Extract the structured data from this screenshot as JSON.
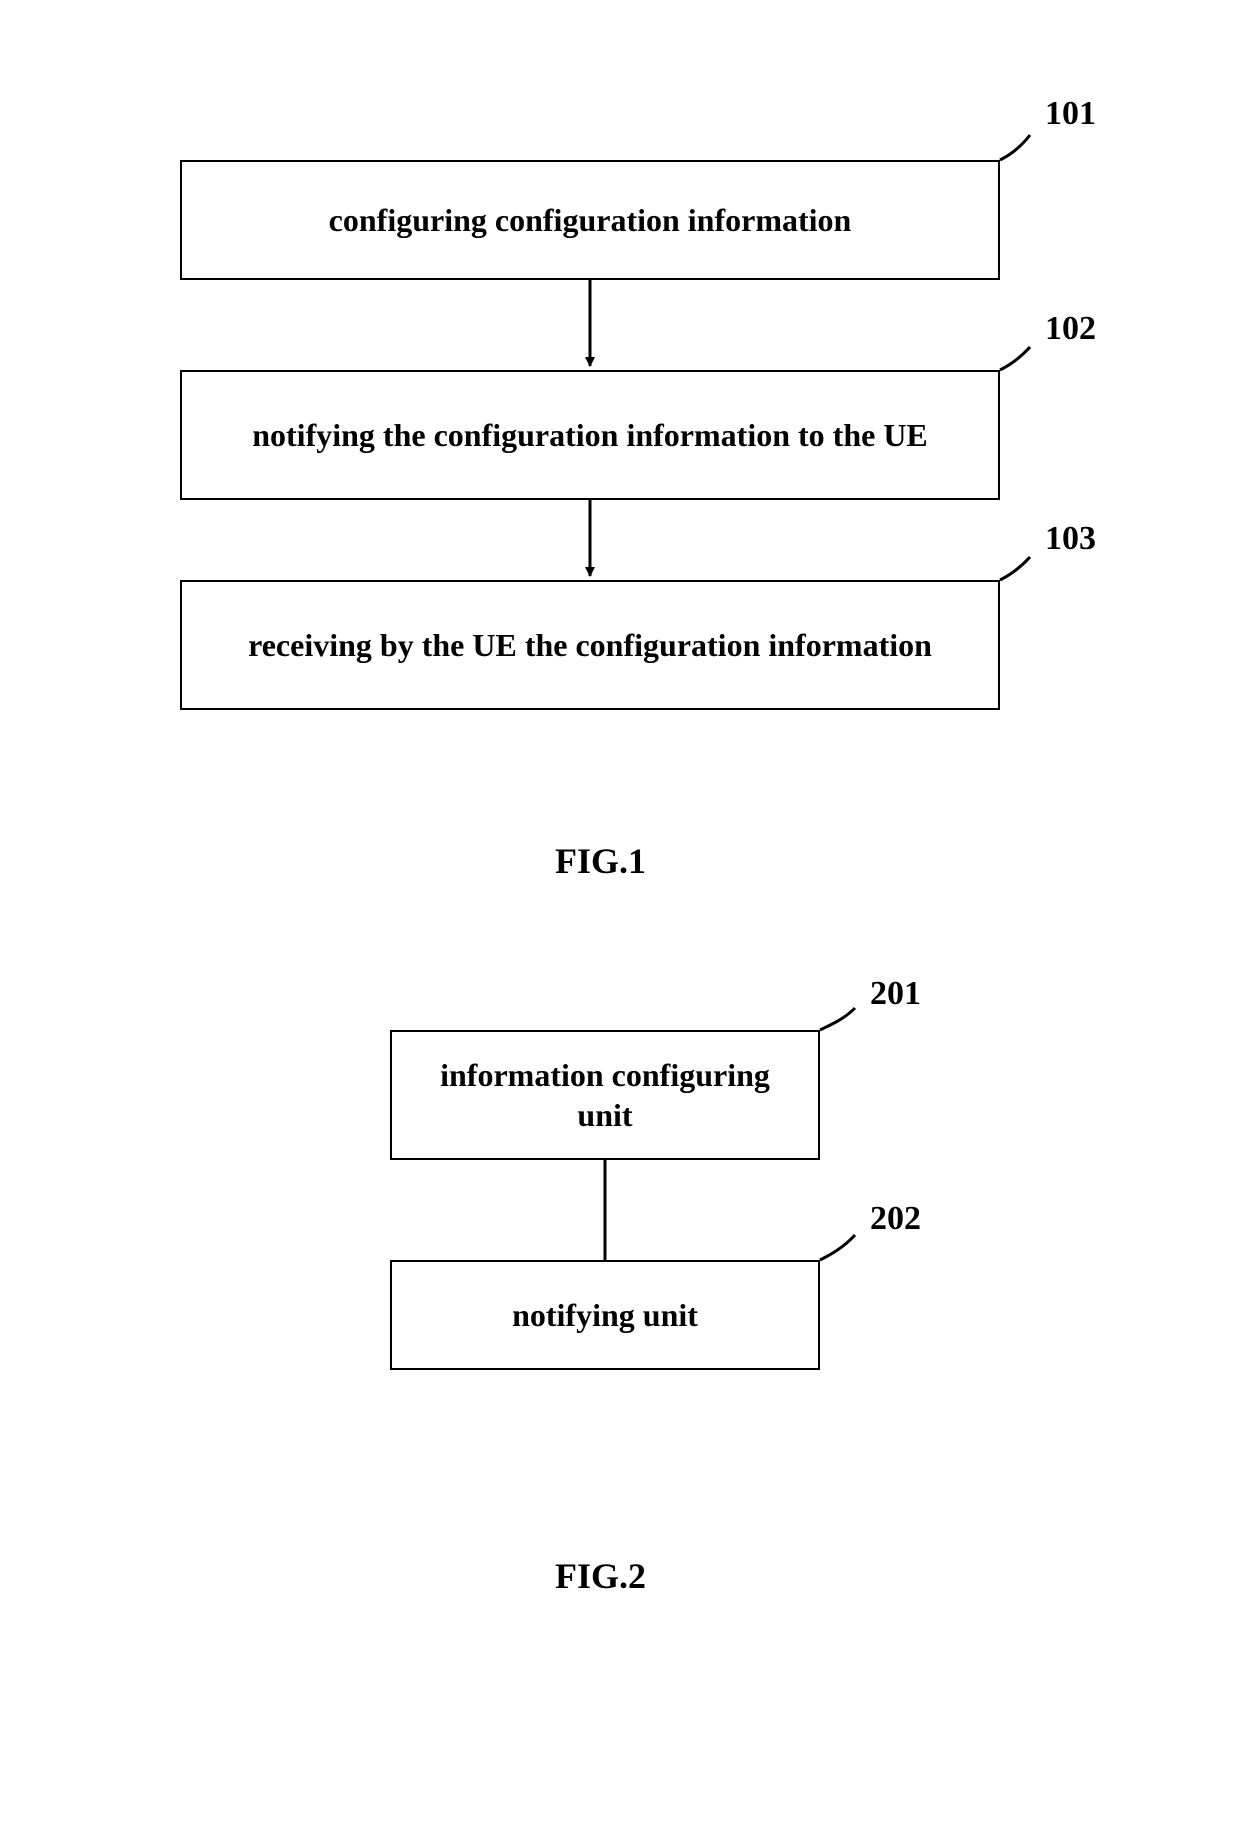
{
  "fig1": {
    "ref101": "101",
    "ref102": "102",
    "ref103": "103",
    "box101": "configuring configuration information",
    "box102": "notifying the configuration information to the UE",
    "box103": "receiving by the UE the configuration information",
    "caption": "FIG.1"
  },
  "fig2": {
    "ref201": "201",
    "ref202": "202",
    "box201": "information configuring unit",
    "box202": "notifying unit",
    "caption": "FIG.2"
  }
}
